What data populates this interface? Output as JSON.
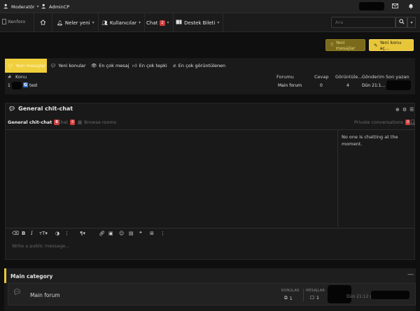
{
  "staffbar": {
    "moderator_label": "Moderatör",
    "admincp_label": "AdminCP"
  },
  "nav": {
    "logo_text": "Xenforo",
    "items": [
      {
        "label": "Neler yeni"
      },
      {
        "label": "Kullanıcılar"
      },
      {
        "label": "Chat",
        "badge": "2"
      },
      {
        "label": "Destek Bileti"
      }
    ],
    "search_placeholder": "Ara"
  },
  "actions": {
    "new_message": "Yeni mesajlar",
    "new_topic": "Yeni konu aç..."
  },
  "latest": {
    "tabs": [
      "Yeni mesajlar",
      "Yeni konular",
      "En çok mesaj",
      "En çok tepki",
      "En çok görüntülenen"
    ],
    "columns": [
      "#",
      "Konu",
      "Forumu",
      "Cevap",
      "Görüntüle...",
      "Gönderim",
      "Son yazan"
    ],
    "rows": [
      {
        "num": "1",
        "prefix": "G",
        "title": "test",
        "forum": "Main forum",
        "replies": "0",
        "views": "4",
        "date": "Dün 21:1..."
      }
    ]
  },
  "chat": {
    "title": "General chit-chat",
    "subtabs": {
      "general": "General chit-chat",
      "general_badge": "0",
      "chat": "Chat",
      "chat_badge": "0",
      "browse": "Browse rooms",
      "private": "Private conversations",
      "private_badge": "0"
    },
    "sidebar_text": "No one is chatting at the moment.",
    "input_placeholder": "Write a public message..."
  },
  "category": {
    "title": "Main category",
    "forum": {
      "name": "Main forum",
      "topics_label": "KONULAR",
      "topics_value": "1",
      "messages_label": "MESAJLAR",
      "messages_value": "1",
      "last_date": "Dün 21:12 da"
    }
  },
  "colors": {
    "accent_yellow": "#e8c63a",
    "badge_red": "#d23f3f",
    "background": "#0f0f0f"
  }
}
